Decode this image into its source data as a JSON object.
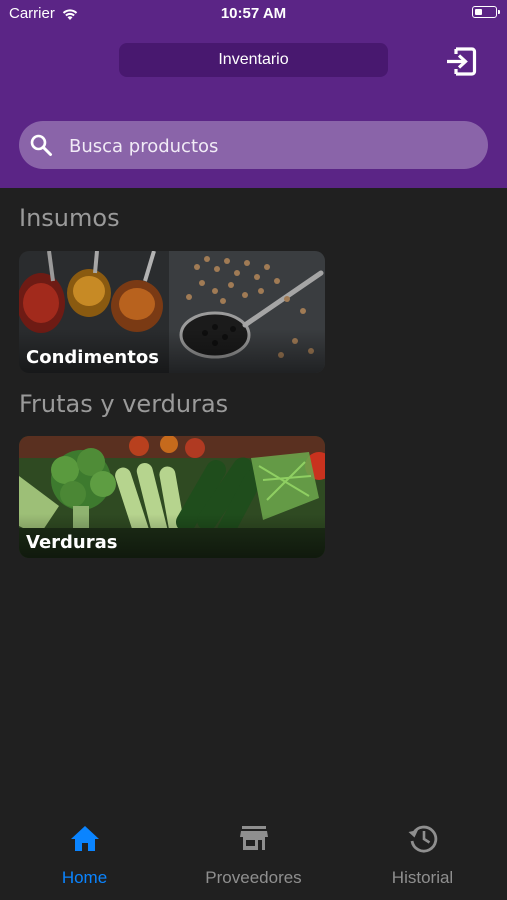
{
  "status_bar": {
    "carrier": "Carrier",
    "time": "10:57 AM"
  },
  "header": {
    "title": "Inventario",
    "logout_icon": "logout-icon"
  },
  "search": {
    "placeholder": "Busca productos",
    "value": ""
  },
  "sections": [
    {
      "title": "Insumos",
      "cards": [
        {
          "label": "Condimentos"
        }
      ]
    },
    {
      "title": "Frutas y verduras",
      "cards": [
        {
          "label": "Verduras"
        }
      ]
    }
  ],
  "tabs": [
    {
      "label": "Home",
      "icon": "home-icon",
      "active": true
    },
    {
      "label": "Proveedores",
      "icon": "store-icon",
      "active": false
    },
    {
      "label": "Historial",
      "icon": "history-icon",
      "active": false
    }
  ],
  "colors": {
    "header": "#5b2586",
    "accent": "#0a84ff",
    "background": "#202020"
  }
}
